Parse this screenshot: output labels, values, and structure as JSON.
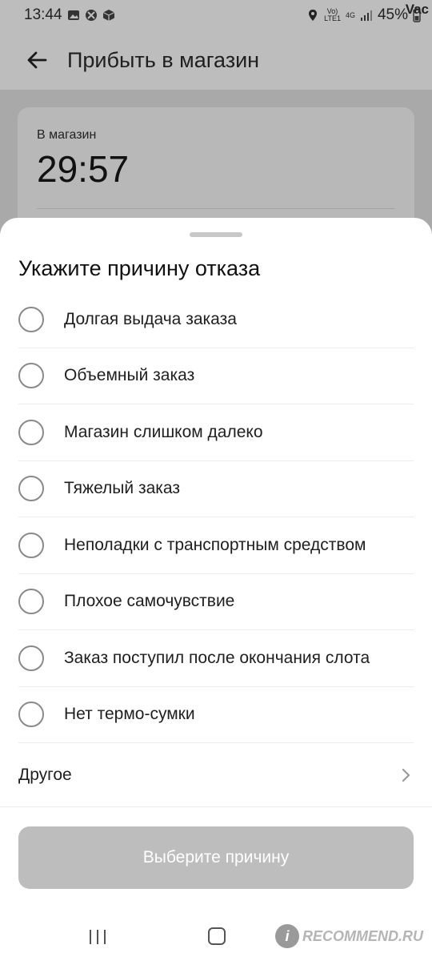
{
  "status_bar": {
    "time": "13:44",
    "network_top": "Vo)",
    "network_bottom": "LTE1",
    "network_type": "4G",
    "battery": "45%",
    "corner_label": "Vac",
    "icons": [
      "image-icon",
      "vpn-icon",
      "package-icon",
      "location-icon",
      "signal-icon",
      "battery-icon"
    ]
  },
  "app_bar": {
    "title": "Прибыть в магазин"
  },
  "store_card": {
    "label": "В магазин",
    "timer": "29:57"
  },
  "sheet": {
    "title": "Укажите причину отказа",
    "reasons": [
      "Долгая выдача заказа",
      "Объемный заказ",
      "Магазин слишком далеко",
      "Тяжелый заказ",
      "Неполадки с транспортным средством",
      "Плохое самочувствие",
      "Заказ поступил после окончания слота",
      "Нет термо-сумки"
    ],
    "other_label": "Другое",
    "submit_label": "Выберите причину"
  },
  "watermark": {
    "badge": "i",
    "text": "RECOMMEND.RU"
  },
  "colors": {
    "dim_overlay": "#bdbdbd",
    "button_disabled": "#bdbdbd",
    "radio_border": "#8a8a8a"
  }
}
